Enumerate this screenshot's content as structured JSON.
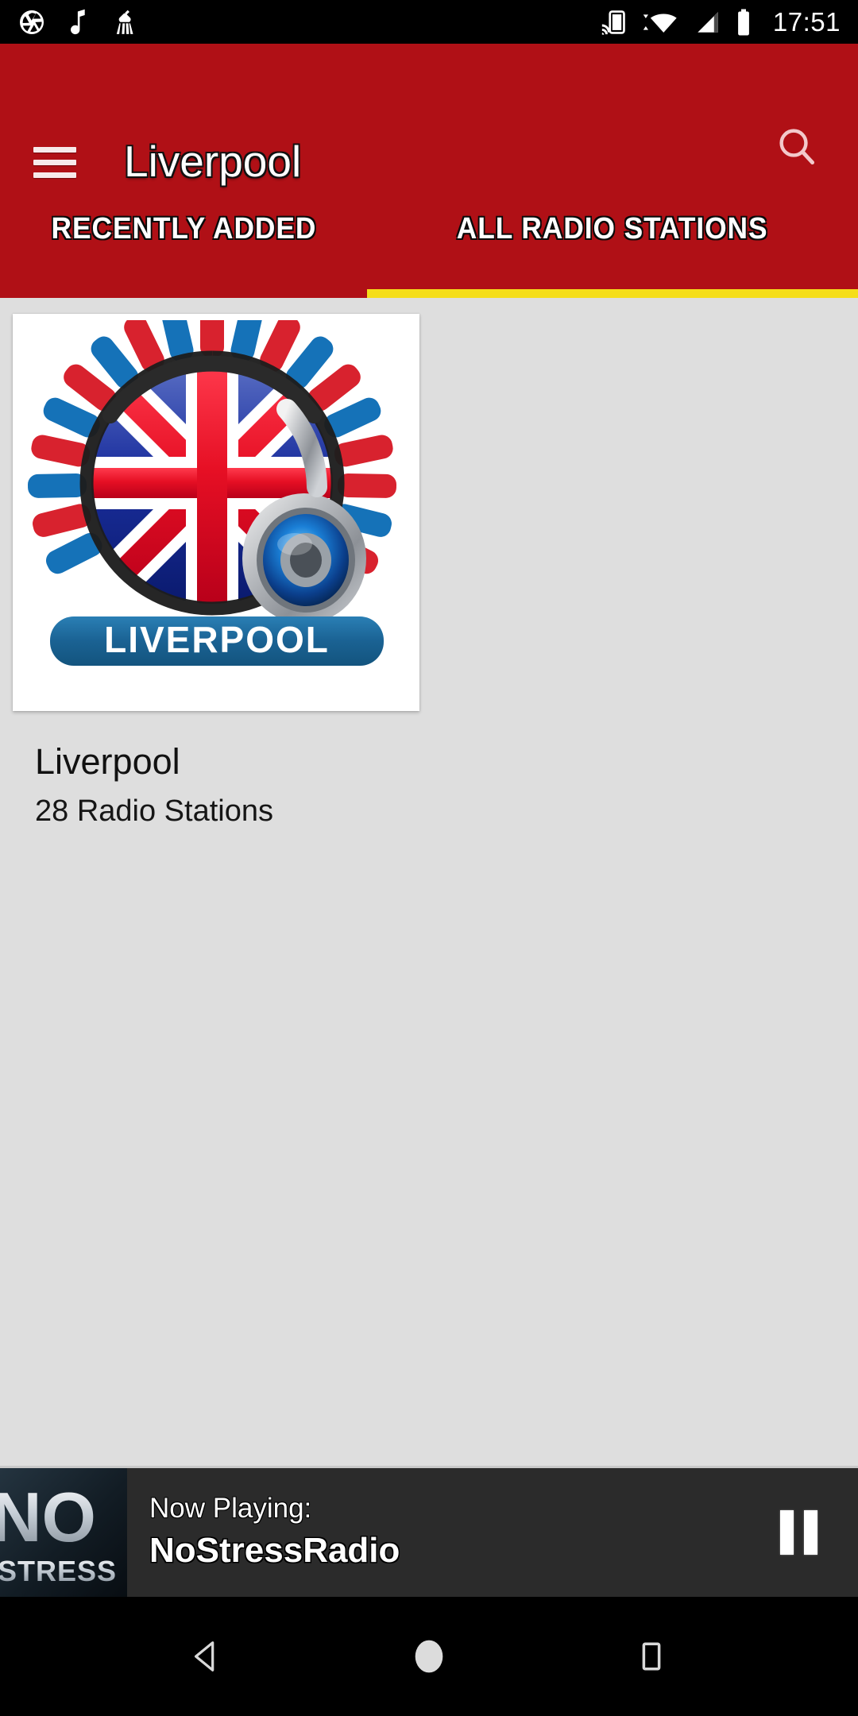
{
  "status_bar": {
    "time": "17:51",
    "left_icons": [
      "camera-aperture-icon",
      "music-note-icon",
      "cleaner-broom-icon"
    ],
    "right_icons": [
      "cast-screen-icon",
      "wifi-icon",
      "cellular-signal-icon",
      "battery-icon"
    ]
  },
  "app_bar": {
    "title": "Liverpool",
    "menu_icon": "hamburger-menu-icon",
    "search_icon": "search-icon",
    "background_color": "#B01016"
  },
  "tabs": {
    "items": [
      {
        "label": "RECENTLY ADDED",
        "active": false
      },
      {
        "label": "ALL RADIO STATIONS",
        "active": true
      }
    ],
    "indicator_color": "#F5DE19"
  },
  "content": {
    "background_color": "#DEDEDE",
    "cards": [
      {
        "title": "Liverpool",
        "subtitle": "28 Radio Stations",
        "artwork_banner_text": "LIVERPOOL",
        "artwork_name": "liverpool-uk-flag-headphones-logo"
      }
    ]
  },
  "player": {
    "now_playing_label": "Now Playing:",
    "station_name": "NoStressRadio",
    "artwork_line1": "NO",
    "artwork_line2": "STRESS",
    "control_icon": "pause-icon",
    "background_color": "#2B2B2B"
  },
  "navigation_bar": {
    "back_icon": "back-triangle-icon",
    "home_icon": "home-circle-icon",
    "recents_icon": "recents-square-icon"
  }
}
